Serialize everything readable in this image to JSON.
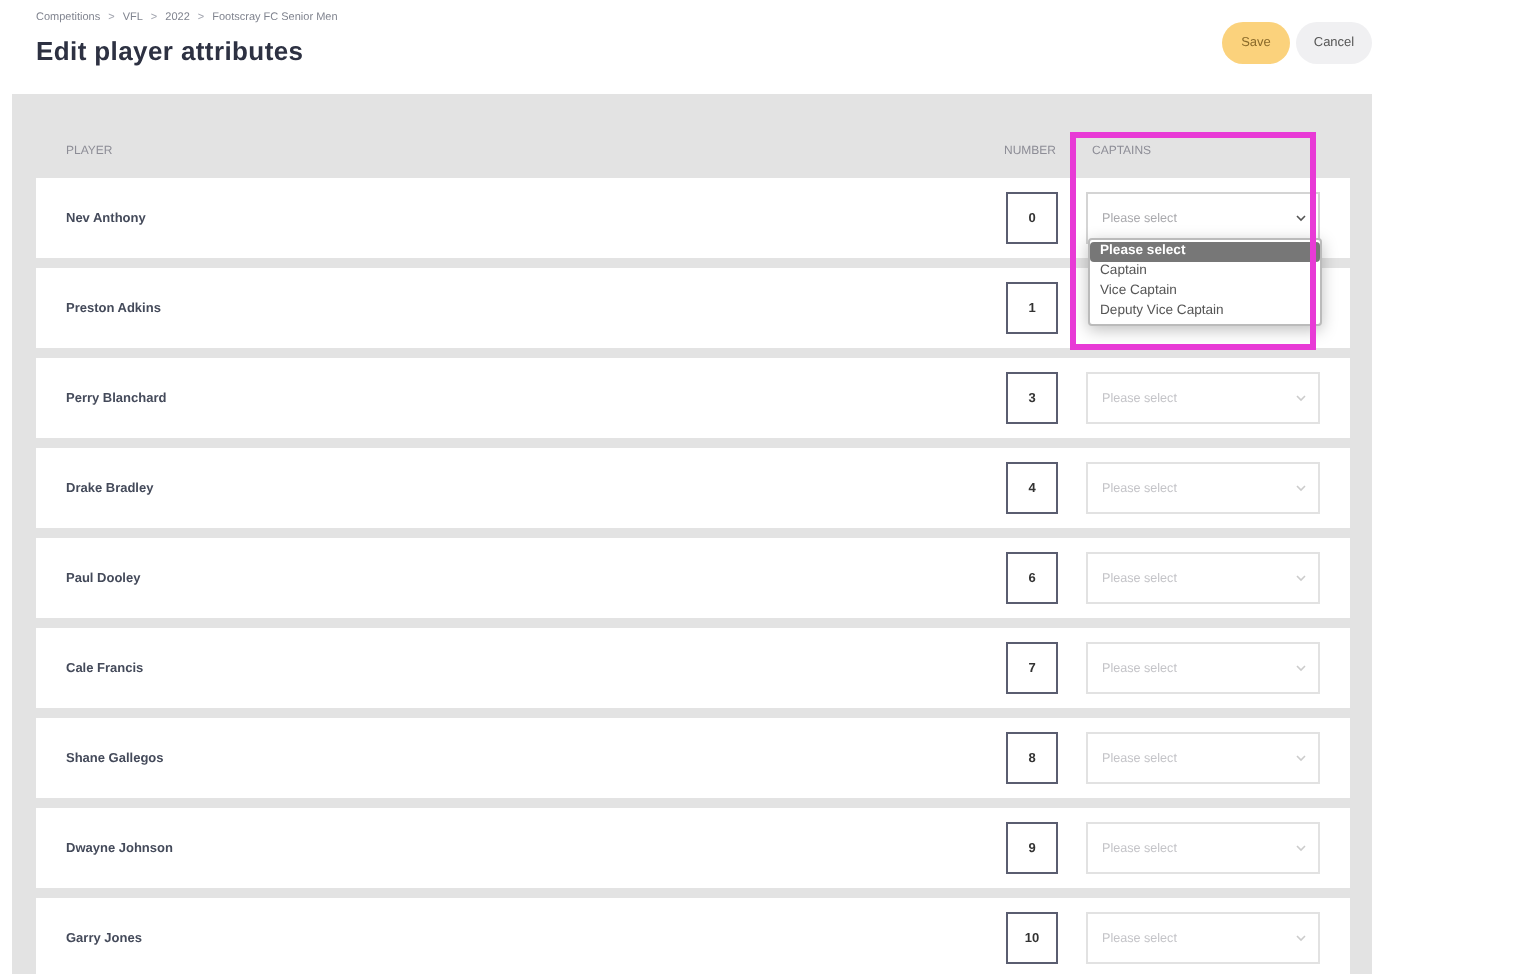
{
  "breadcrumb": [
    {
      "kind": "link",
      "text": "Competitions"
    },
    {
      "kind": "separator",
      "text": ">"
    },
    {
      "kind": "link",
      "text": "VFL"
    },
    {
      "kind": "separator",
      "text": ">"
    },
    {
      "kind": "link",
      "text": "2022"
    },
    {
      "kind": "separator",
      "text": ">"
    },
    {
      "kind": "link",
      "text": "Footscray FC Senior Men"
    }
  ],
  "title": "Edit player attributes",
  "actions": [
    {
      "kind": "primary",
      "label": "Save",
      "disabled": true
    },
    {
      "kind": "secondary",
      "label": "Cancel",
      "disabled": false
    }
  ],
  "table": {
    "columns": [
      "PLAYER",
      "NUMBER",
      "CAPTAINS"
    ],
    "rows": [
      {
        "player": "Nev Anthony",
        "number": "0",
        "captain": {
          "placeholder": "Please select",
          "expanded": true,
          "options": [
            {
              "label": "Please select",
              "selected": true
            },
            {
              "label": "Captain",
              "selected": false
            },
            {
              "label": "Vice Captain",
              "selected": false
            },
            {
              "label": "Deputy Vice Captain",
              "selected": false
            }
          ]
        }
      },
      {
        "player": "Preston Adkins",
        "number": "1"
      },
      {
        "player": "Perry Blanchard",
        "number": "3",
        "captain": {
          "placeholder": "Please select",
          "expanded": false
        }
      },
      {
        "player": "Drake Bradley",
        "number": "4",
        "captain": {
          "placeholder": "Please select",
          "expanded": false
        }
      },
      {
        "player": "Paul Dooley",
        "number": "6",
        "captain": {
          "placeholder": "Please select",
          "expanded": false
        }
      },
      {
        "player": "Cale Francis",
        "number": "7",
        "captain": {
          "placeholder": "Please select",
          "expanded": false
        }
      },
      {
        "player": "Shane Gallegos",
        "number": "8",
        "captain": {
          "placeholder": "Please select",
          "expanded": false
        }
      },
      {
        "player": "Dwayne Johnson",
        "number": "9",
        "captain": {
          "placeholder": "Please select",
          "expanded": false
        }
      },
      {
        "player": "Garry Jones",
        "number": "10",
        "captain": {
          "placeholder": "Please select",
          "expanded": false
        }
      }
    ]
  }
}
